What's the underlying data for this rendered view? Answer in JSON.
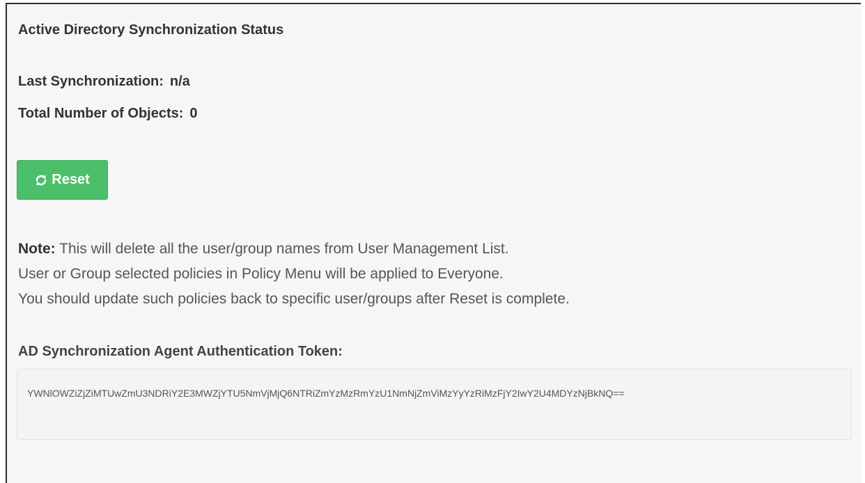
{
  "status": {
    "title": "Active Directory Synchronization Status",
    "last_sync_label": "Last Synchronization:",
    "last_sync_value": "n/a",
    "total_objects_label": "Total Number of Objects:",
    "total_objects_value": "0"
  },
  "reset_button": {
    "label": "Reset",
    "icon": "refresh-icon",
    "color": "#4cbf6b"
  },
  "note": {
    "label": "Note:",
    "line1": "This will delete all the user/group names from User Management List.",
    "line2": "User or Group selected policies in Policy Menu will be applied to Everyone.",
    "line3": "You should update such policies back to specific user/groups after Reset is complete."
  },
  "token": {
    "heading": "AD Synchronization Agent Authentication Token:",
    "value": "YWNlOWZiZjZiMTUwZmU3NDRiY2E3MWZjYTU5NmVjMjQ6NTRiZmYzMzRmYzU1NmNjZmViMzYyYzRiMzFjY2IwY2U4MDYzNjBkNQ=="
  }
}
